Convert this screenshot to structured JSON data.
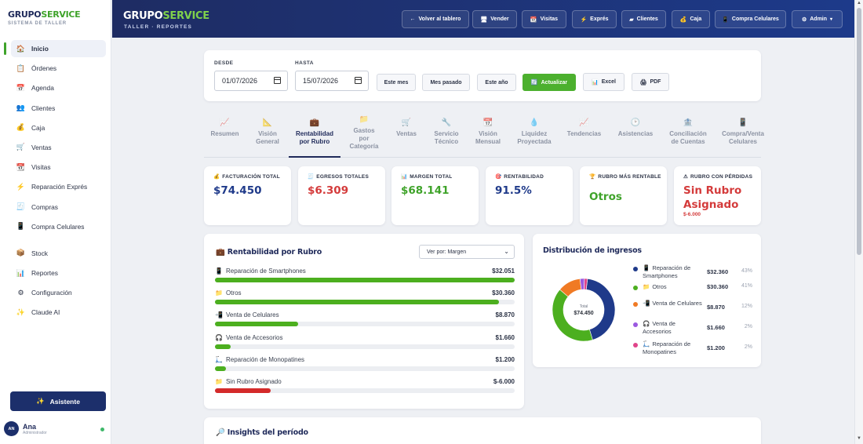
{
  "app": {
    "brand_a": "GRUPO",
    "brand_b": "SERVICE",
    "subtitle": "SISTEMA DE TALLER"
  },
  "sidebar": {
    "items": [
      {
        "label": "Inicio",
        "icon": "house-icon",
        "glyph": "🏠",
        "active": true
      },
      {
        "label": "Órdenes",
        "icon": "clipboard-icon",
        "glyph": "📋"
      },
      {
        "label": "Agenda",
        "icon": "calendar-icon",
        "glyph": "📅"
      },
      {
        "label": "Clientes",
        "icon": "users-icon",
        "glyph": "👥"
      },
      {
        "label": "Caja",
        "icon": "money-bag-icon",
        "glyph": "💰"
      },
      {
        "label": "Ventas",
        "icon": "cart-icon",
        "glyph": "🛒"
      },
      {
        "label": "Visitas",
        "icon": "calendar-grid-icon",
        "glyph": "📆"
      },
      {
        "label": "Reparación Exprés",
        "icon": "lightning-icon",
        "glyph": "⚡"
      },
      {
        "label": "Compras",
        "icon": "receipt-icon",
        "glyph": "🧾"
      },
      {
        "label": "Compra Celulares",
        "icon": "phone-icon",
        "glyph": "📱"
      },
      {
        "label": "Stock",
        "icon": "box-icon",
        "glyph": "📦"
      },
      {
        "label": "Reportes",
        "icon": "bar-chart-icon",
        "glyph": "📊"
      },
      {
        "label": "Configuración",
        "icon": "gear-icon",
        "glyph": "⚙"
      },
      {
        "label": "Claude AI",
        "icon": "sparkle-icon",
        "glyph": "✨"
      }
    ],
    "assistant_label": "Asistente",
    "user": {
      "initials": "AN",
      "name": "Ana",
      "role": "Administrador"
    }
  },
  "header": {
    "title_a": "GRUPO",
    "title_b": "SERVICE",
    "subtitle": "TALLER · REPORTES",
    "buttons": [
      {
        "label": "Volver al tablero",
        "glyph": "←"
      },
      {
        "label": "Vender",
        "glyph": "🖥"
      },
      {
        "label": "Visitas",
        "glyph": "📆"
      },
      {
        "label": "Exprés",
        "glyph": "⚡"
      },
      {
        "label": "Clientes",
        "glyph": "▰"
      },
      {
        "label": "Caja",
        "glyph": "💰"
      },
      {
        "label": "Compra Celulares",
        "glyph": "📱"
      },
      {
        "label": "Admin",
        "glyph": "⚙"
      }
    ]
  },
  "filters": {
    "desde_label": "DESDE",
    "desde_value": "01/07/2026",
    "hasta_label": "HASTA",
    "hasta_value": "15/07/2026",
    "buttons": [
      "Este mes",
      "Mes pasado",
      "Este año"
    ],
    "actualizar": "Actualizar",
    "excel": "Excel",
    "pdf": "PDF"
  },
  "tabs": [
    {
      "line1": "Resumen",
      "line2": "",
      "glyph": "📈"
    },
    {
      "line1": "Visión",
      "line2": "General",
      "glyph": "📐"
    },
    {
      "line1": "Rentabilidad",
      "line2": "por Rubro",
      "glyph": "💼",
      "active": true
    },
    {
      "line1": "Gastos",
      "line2": "por",
      "line3": "Categoría",
      "glyph": "📁"
    },
    {
      "line1": "Ventas",
      "line2": "",
      "glyph": "🛒"
    },
    {
      "line1": "Servicio",
      "line2": "Técnico",
      "glyph": "🔧"
    },
    {
      "line1": "Visión",
      "line2": "Mensual",
      "glyph": "📆"
    },
    {
      "line1": "Liquidez",
      "line2": "Proyectada",
      "glyph": "💧"
    },
    {
      "line1": "Tendencias",
      "line2": "",
      "glyph": "📈"
    },
    {
      "line1": "Asistencias",
      "line2": "",
      "glyph": "🕑"
    },
    {
      "line1": "Conciliación",
      "line2": "de Cuentas",
      "glyph": "🏦"
    },
    {
      "line1": "Compra/Venta",
      "line2": "Celulares",
      "glyph": "📱"
    }
  ],
  "kpis": [
    {
      "label": "FACTURACIÓN TOTAL",
      "value": "$74.450",
      "color": "#1f3a8a",
      "glyph": "💰"
    },
    {
      "label": "EGRESOS TOTALES",
      "value": "$6.309",
      "color": "#d43b3b",
      "glyph": "🧾"
    },
    {
      "label": "MARGEN TOTAL",
      "value": "$68.141",
      "color": "#3fa32a",
      "glyph": "📊"
    },
    {
      "label": "RENTABILIDAD",
      "value": "91.5%",
      "color": "#1f3a8a",
      "glyph": "🎯"
    },
    {
      "label": "RUBRO MÁS RENTABLE",
      "value": "Otros",
      "color": "#3fa32a",
      "glyph": "🏆"
    },
    {
      "label": "RUBRO CON PÉRDIDAS",
      "value": "Sin Rubro Asignado",
      "sub": "$-6.000",
      "color": "#d43b3b",
      "glyph": "⚠"
    }
  ],
  "rentabilidad": {
    "title": "Rentabilidad por Rubro",
    "select": "Ver por: Margen",
    "rows": [
      {
        "name": "Reparación de Smartphones",
        "value": "$32.051",
        "fraction": 1.0,
        "color": "#4caf1f",
        "glyph": "📱"
      },
      {
        "name": "Otros",
        "value": "$30.360",
        "fraction": 0.947,
        "color": "#4caf1f",
        "glyph": "📁"
      },
      {
        "name": "Venta de Celulares",
        "value": "$8.870",
        "fraction": 0.277,
        "color": "#4caf1f",
        "glyph": "📲"
      },
      {
        "name": "Venta de Accesorios",
        "value": "$1.660",
        "fraction": 0.052,
        "color": "#4caf1f",
        "glyph": "🎧"
      },
      {
        "name": "Reparación de Monopatines",
        "value": "$1.200",
        "fraction": 0.037,
        "color": "#4caf1f",
        "glyph": "🛴"
      },
      {
        "name": "Sin Rubro Asignado",
        "value": "$-6.000",
        "fraction": 0.187,
        "color": "#d42a2a",
        "glyph": "📁"
      }
    ]
  },
  "distribucion": {
    "title": "Distribución de ingresos",
    "total_label": "Total",
    "total_value": "$74.450",
    "items": [
      {
        "name": "Reparación de Smartphones",
        "value": "$32.360",
        "pct": "43%",
        "share": 0.4347,
        "color": "#1f3a8a",
        "glyph": "📱"
      },
      {
        "name": "Otros",
        "value": "$30.360",
        "pct": "41%",
        "share": 0.4078,
        "color": "#4caf1f",
        "glyph": "📁"
      },
      {
        "name": "Venta de Celulares",
        "value": "$8.870",
        "pct": "12%",
        "share": 0.1191,
        "color": "#f07a24",
        "glyph": "📲"
      },
      {
        "name": "Venta de Accesorios",
        "value": "$1.660",
        "pct": "2%",
        "share": 0.0223,
        "color": "#9b59e0",
        "glyph": "🎧"
      },
      {
        "name": "Reparación de Monopatines",
        "value": "$1.200",
        "pct": "2%",
        "share": 0.0161,
        "color": "#e0448a",
        "glyph": "🛴"
      }
    ]
  },
  "insights": {
    "title": "Insights del período",
    "glyph": "🔎"
  }
}
